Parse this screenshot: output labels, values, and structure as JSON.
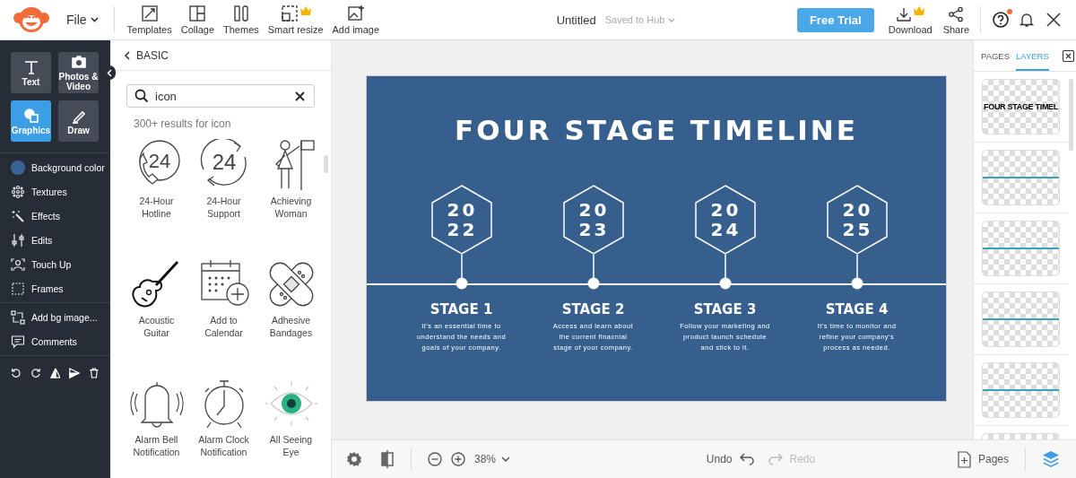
{
  "topbar": {
    "file_menu": "File",
    "tools": [
      {
        "label": "Templates",
        "kind": "templates",
        "premium": false
      },
      {
        "label": "Collage",
        "kind": "collage",
        "premium": false
      },
      {
        "label": "Themes",
        "kind": "themes",
        "premium": false
      },
      {
        "label": "Smart resize",
        "kind": "resize",
        "premium": true
      },
      {
        "label": "Add image",
        "kind": "image",
        "premium": false
      }
    ],
    "doc_title": "Untitled",
    "save_status": "Saved to Hub",
    "trial_button": "Free Trial",
    "actions": [
      {
        "label": "Download",
        "kind": "download",
        "premium": true
      },
      {
        "label": "Share",
        "kind": "share",
        "premium": false
      }
    ],
    "help_badge": true
  },
  "sidebar": {
    "tools": [
      {
        "label": "Text",
        "kind": "text",
        "selected": false
      },
      {
        "label": "Photos & Video",
        "kind": "photo",
        "selected": false
      },
      {
        "label": "Graphics",
        "kind": "graphics",
        "selected": true
      },
      {
        "label": "Draw",
        "kind": "draw",
        "selected": false
      }
    ],
    "items": [
      {
        "label": "Background color",
        "kind": "swatch",
        "color": "#3a6398"
      },
      {
        "label": "Textures",
        "kind": "textures"
      },
      {
        "label": "Effects",
        "kind": "effects"
      },
      {
        "label": "Edits",
        "kind": "edits"
      },
      {
        "label": "Touch Up",
        "kind": "touchup"
      },
      {
        "label": "Frames",
        "kind": "frames"
      }
    ],
    "extra_items": [
      {
        "label": "Add bg image...",
        "kind": "bgimage"
      },
      {
        "label": "Comments",
        "kind": "comments"
      }
    ]
  },
  "graphics_panel": {
    "back": "BASIC",
    "search": {
      "value": "icon"
    },
    "results": "300+ results for icon",
    "icons": [
      {
        "label": "24-Hour Hotline",
        "kind": "phone",
        "glyph": "24"
      },
      {
        "label": "24-Hour Support",
        "kind": "cycle",
        "glyph": "24"
      },
      {
        "label": "Achieving Woman",
        "kind": "woman"
      },
      {
        "label": "Acoustic Guitar",
        "kind": "guitar"
      },
      {
        "label": "Add to Calendar",
        "kind": "calendar"
      },
      {
        "label": "Adhesive Bandages",
        "kind": "bandage"
      },
      {
        "label": "Alarm Bell Notification",
        "kind": "bell"
      },
      {
        "label": "Alarm Clock Notification",
        "kind": "clock"
      },
      {
        "label": "All Seeing Eye",
        "kind": "eye"
      }
    ]
  },
  "slide": {
    "title": "FOUR STAGE TIMELINE",
    "stages": [
      {
        "year_lines": [
          "20",
          "22"
        ],
        "title": "STAGE 1",
        "text_lines": [
          "It's an essential time to",
          "understand the needs and",
          "goals of your company."
        ]
      },
      {
        "year_lines": [
          "20",
          "23"
        ],
        "title": "STAGE 2",
        "text_lines": [
          "Access and learn about",
          "the current finacnial",
          "stage of your company."
        ]
      },
      {
        "year_lines": [
          "20",
          "24"
        ],
        "title": "STAGE 3",
        "text_lines": [
          "Follow your marketing and",
          "product launch schedule",
          "and stick to it."
        ]
      },
      {
        "year_lines": [
          "20",
          "25"
        ],
        "title": "STAGE 4",
        "text_lines": [
          "It's time to monitor and",
          "refine your company's",
          "process as needed."
        ]
      }
    ]
  },
  "layers_panel": {
    "tabs": [
      {
        "label": "PAGES",
        "selected": false
      },
      {
        "label": "LAYERS",
        "selected": true
      }
    ],
    "layers": [
      {
        "kind": "text",
        "label": "FOUR STAGE TIMEL"
      },
      {
        "kind": "line"
      },
      {
        "kind": "line"
      },
      {
        "kind": "line"
      },
      {
        "kind": "line"
      },
      {
        "kind": "blank"
      }
    ]
  },
  "bottom_bar": {
    "zoom": "38%",
    "undo": {
      "label": "Undo",
      "disabled": false
    },
    "redo": {
      "label": "Redo",
      "disabled": true
    },
    "pages": "Pages"
  }
}
